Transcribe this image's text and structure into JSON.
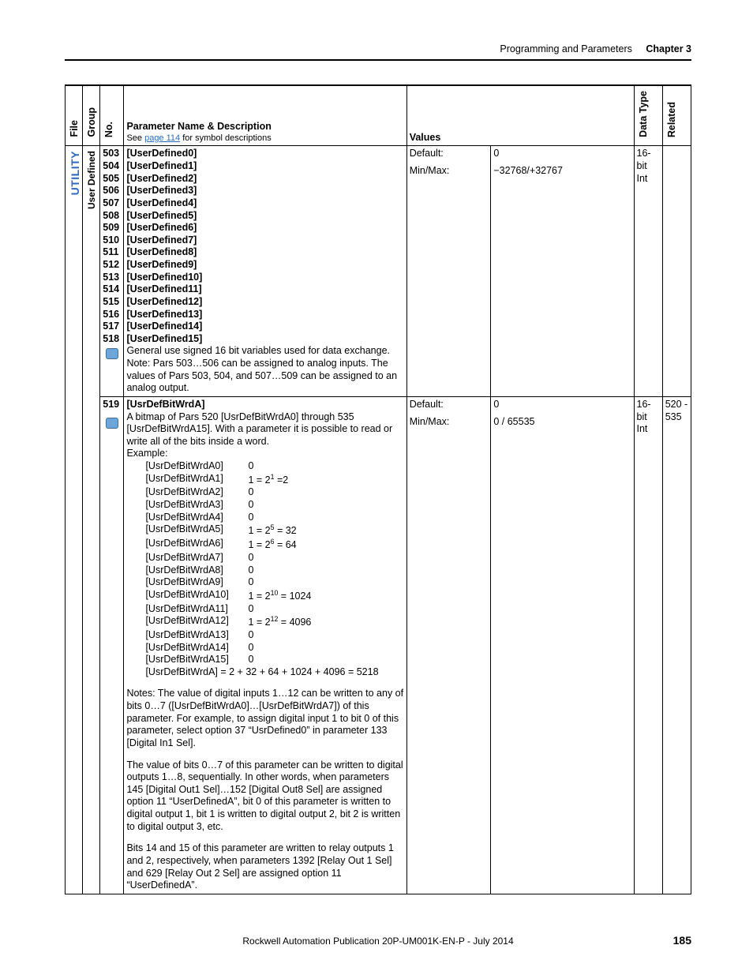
{
  "header": {
    "title": "Programming and Parameters",
    "chapter": "Chapter 3"
  },
  "columns": {
    "file": "File",
    "group": "Group",
    "no": "No.",
    "param_head": "Parameter Name & Description",
    "param_sub_pre": "See ",
    "param_sub_link": "page 114",
    "param_sub_post": " for symbol descriptions",
    "values": "Values",
    "datatype": "Data Type",
    "related": "Related"
  },
  "file_label": "UTILITY",
  "group_label": "User Defined",
  "row1": {
    "numbers": [
      "503",
      "504",
      "505",
      "506",
      "507",
      "508",
      "509",
      "510",
      "511",
      "512",
      "513",
      "514",
      "515",
      "516",
      "517",
      "518"
    ],
    "names": [
      "[UserDefined0]",
      "[UserDefined1]",
      "[UserDefined2]",
      "[UserDefined3]",
      "[UserDefined4]",
      "[UserDefined5]",
      "[UserDefined6]",
      "[UserDefined7]",
      "[UserDefined8]",
      "[UserDefined9]",
      "[UserDefined10]",
      "[UserDefined11]",
      "[UserDefined12]",
      "[UserDefined13]",
      "[UserDefined14]",
      "[UserDefined15]"
    ],
    "note1": "General use signed 16 bit variables used for data exchange.",
    "note2": "Note: Pars 503…506 can be assigned to analog inputs. The values of Pars 503, 504, and 507…509 can be assigned to an analog output.",
    "default_lbl": "Default:",
    "default_val": "0",
    "minmax_lbl": "Min/Max:",
    "minmax_val": "−32768/+32767",
    "dtype1": "16-bit",
    "dtype2": "Int",
    "related": ""
  },
  "row2": {
    "no": "519",
    "name": "[UsrDefBitWrdA]",
    "intro": "A bitmap of Pars 520 [UsrDefBitWrdA0] through 535 [UsrDefBitWrdA15]. With a parameter it is possible to read or write all of the bits inside a word.",
    "example_label": "Example:",
    "bits": [
      {
        "lbl": "[UsrDefBitWrdA0]",
        "val": "0"
      },
      {
        "lbl": "[UsrDefBitWrdA1]",
        "val": "1 = 2<sup>1</sup> =2"
      },
      {
        "lbl": "[UsrDefBitWrdA2]",
        "val": "0"
      },
      {
        "lbl": "[UsrDefBitWrdA3]",
        "val": "0"
      },
      {
        "lbl": "[UsrDefBitWrdA4]",
        "val": "0"
      },
      {
        "lbl": "[UsrDefBitWrdA5]",
        "val": "1 = 2<sup>5</sup> = 32"
      },
      {
        "lbl": "[UsrDefBitWrdA6]",
        "val": "1 = 2<sup>6</sup> = 64"
      },
      {
        "lbl": "[UsrDefBitWrdA7]",
        "val": "0"
      },
      {
        "lbl": "[UsrDefBitWrdA8]",
        "val": "0"
      },
      {
        "lbl": "[UsrDefBitWrdA9]",
        "val": "0"
      },
      {
        "lbl": "[UsrDefBitWrdA10]",
        "val": "1 = 2<sup>10</sup> = 1024"
      },
      {
        "lbl": "[UsrDefBitWrdA11]",
        "val": "0"
      },
      {
        "lbl": "[UsrDefBitWrdA12]",
        "val": "1 = 2<sup>12</sup> = 4096"
      },
      {
        "lbl": "[UsrDefBitWrdA13]",
        "val": "0"
      },
      {
        "lbl": "[UsrDefBitWrdA14]",
        "val": "0"
      },
      {
        "lbl": "[UsrDefBitWrdA15]",
        "val": "0"
      }
    ],
    "sum": "[UsrDefBitWrdA] = 2 + 32 + 64 + 1024 + 4096 = 5218",
    "notes1": "Notes: The value of digital inputs 1…12 can be written to any of bits 0…7 ([UsrDefBitWrdA0]…[UsrDefBitWrdA7]) of this parameter. For example, to assign digital input 1 to bit 0 of this parameter, select option 37 “UsrDefined0” in parameter 133 [Digital In1 Sel].",
    "notes2": "The value of bits 0…7 of this parameter can be written to digital outputs 1…8, sequentially. In other words, when parameters 145 [Digital Out1 Sel]…152 [Digital Out8 Sel] are assigned option 11 “UserDefinedA”, bit 0 of this parameter is written to digital output 1, bit 1 is written to digital output 2, bit 2 is written to digital output 3, etc.",
    "notes3": "Bits 14 and 15 of this parameter are written to relay outputs 1 and 2, respectively, when parameters 1392 [Relay Out 1 Sel] and 629 [Relay Out 2 Sel] are assigned option 11 “UserDefinedA”.",
    "default_lbl": "Default:",
    "default_val": "0",
    "minmax_lbl": "Min/Max:",
    "minmax_val": "0 / 65535",
    "dtype1": "16-bit",
    "dtype2": "Int",
    "related": "520 - 535"
  },
  "footer": {
    "pub": "Rockwell Automation Publication 20P-UM001K-EN-P - July 2014",
    "page": "185"
  }
}
